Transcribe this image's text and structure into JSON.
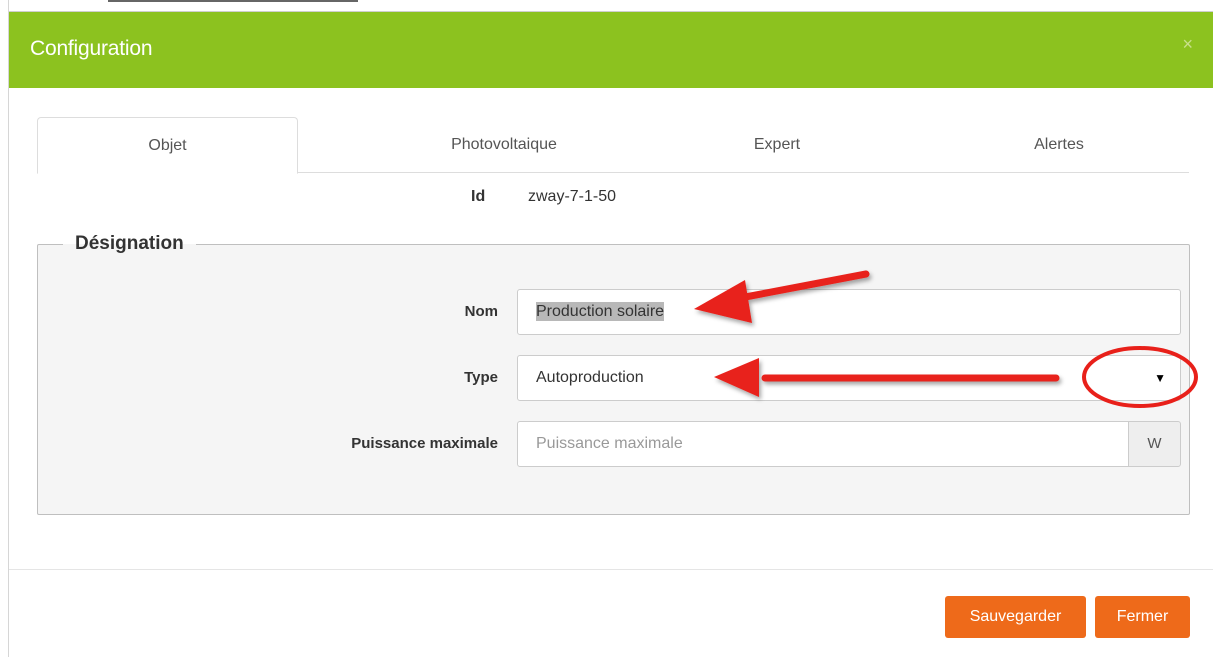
{
  "dialog": {
    "title": "Configuration",
    "close_glyph": "×"
  },
  "tabs": [
    {
      "label": "Objet",
      "active": true
    },
    {
      "label": "Photovoltaique",
      "active": false
    },
    {
      "label": "Expert",
      "active": false
    },
    {
      "label": "Alertes",
      "active": false
    }
  ],
  "id_row": {
    "label": "Id",
    "value": "zway-7-1-50"
  },
  "designation": {
    "legend": "Désignation",
    "nom": {
      "label": "Nom",
      "value": "Production solaire"
    },
    "type": {
      "label": "Type",
      "value": "Autoproduction",
      "arrow": "▼"
    },
    "puissance": {
      "label": "Puissance maximale",
      "placeholder": "Puissance maximale",
      "unit": "W"
    }
  },
  "footer": {
    "save_label": "Sauvegarder",
    "close_label": "Fermer"
  },
  "colors": {
    "header": "#8cc21f",
    "button": "#ee6a1a",
    "annotation": "#e8201a"
  }
}
